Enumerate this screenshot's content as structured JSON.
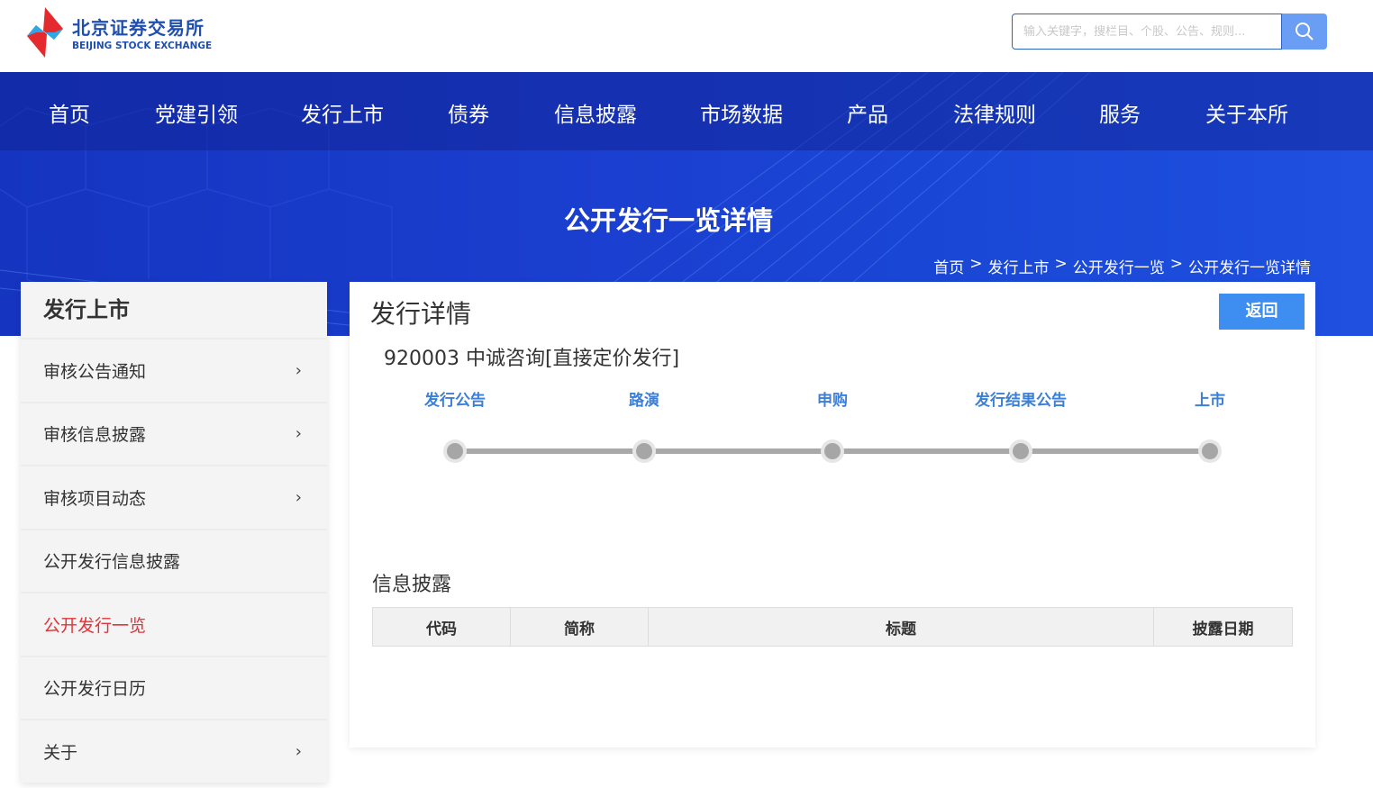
{
  "header": {
    "logo_cn": "北京证券交易所",
    "logo_en": "BEIJING STOCK EXCHANGE",
    "search_placeholder": "输入关键字，搜栏目、个股、公告、规则..."
  },
  "nav": [
    "首页",
    "党建引领",
    "发行上市",
    "债券",
    "信息披露",
    "市场数据",
    "产品",
    "法律规则",
    "服务",
    "关于本所"
  ],
  "banner": {
    "title": "公开发行一览详情",
    "breadcrumb": [
      "首页",
      "发行上市",
      "公开发行一览",
      "公开发行一览详情"
    ],
    "sep": ">"
  },
  "sidebar": {
    "title": "发行上市",
    "items": [
      {
        "label": "审核公告通知",
        "chevron": true
      },
      {
        "label": "审核信息披露",
        "chevron": true
      },
      {
        "label": "审核项目动态",
        "chevron": true
      },
      {
        "label": "公开发行信息披露",
        "chevron": false
      },
      {
        "label": "公开发行一览",
        "chevron": false,
        "active": true
      },
      {
        "label": "公开发行日历",
        "chevron": false
      },
      {
        "label": "关于",
        "chevron": true
      }
    ]
  },
  "content": {
    "title": "发行详情",
    "back_label": "返回",
    "stock": "920003 中诚咨询[直接定价发行]",
    "steps": [
      "发行公告",
      "路演",
      "申购",
      "发行结果公告",
      "上市"
    ],
    "disclosure_title": "信息披露",
    "columns": [
      "代码",
      "简称",
      "标题",
      "披露日期"
    ]
  },
  "colors": {
    "accent": "#3d8ef0",
    "nav": "#1535c0",
    "active": "#e0333a"
  }
}
